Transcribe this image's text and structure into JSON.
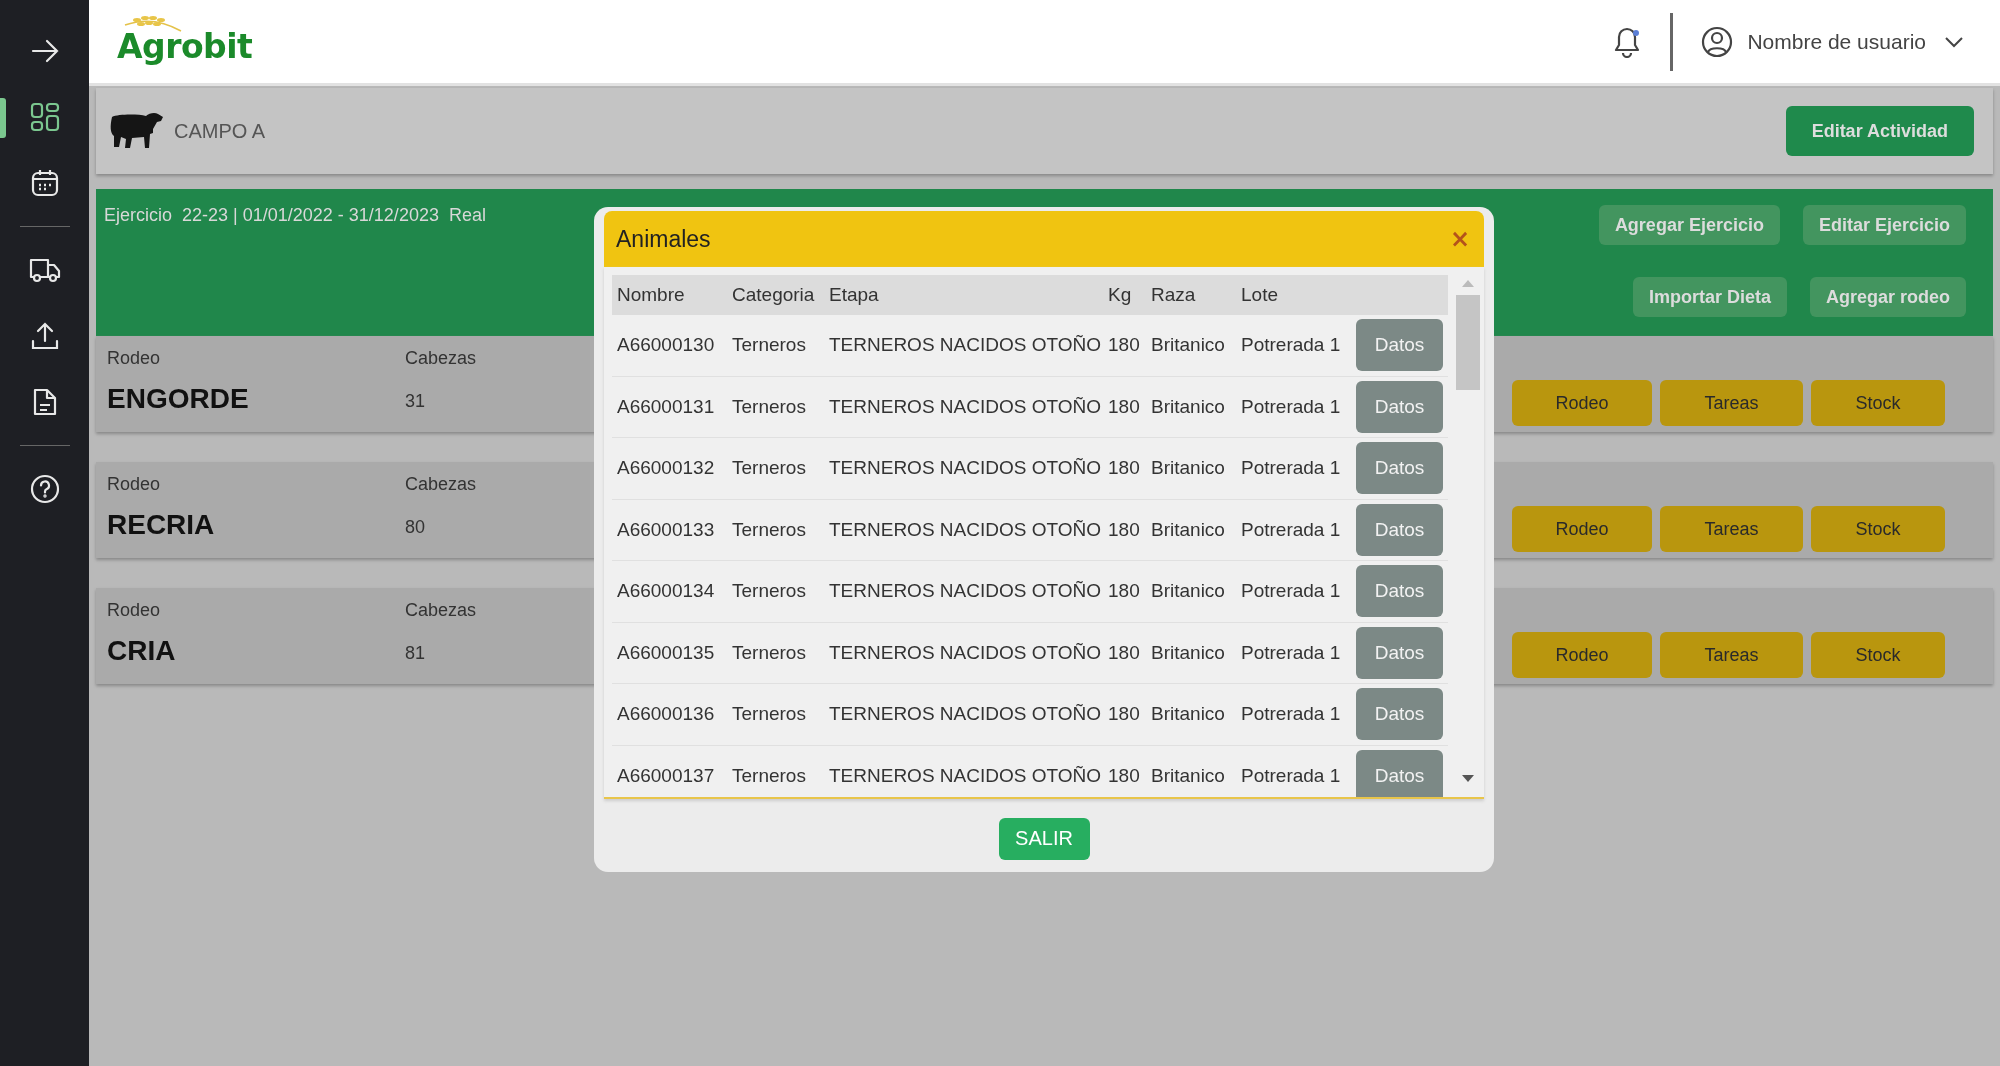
{
  "sidebar": {
    "groups": [
      [
        {
          "kind": "expand",
          "selected": false
        },
        {
          "kind": "dashboard",
          "selected": true
        },
        {
          "kind": "calendar",
          "selected": false
        }
      ],
      [
        {
          "kind": "truck",
          "selected": false
        },
        {
          "kind": "upload",
          "selected": false
        },
        {
          "kind": "document",
          "selected": false
        }
      ],
      [
        {
          "kind": "help",
          "selected": false
        }
      ]
    ]
  },
  "header": {
    "logo": "Agrobit",
    "notification_dot": true,
    "user": "Nombre de usuario"
  },
  "campo": {
    "name": "CAMPO A",
    "button": "Editar Actividad"
  },
  "ejercicio": {
    "label": "Ejercicio",
    "period": "22-23 | 01/01/2022 - 31/12/2023",
    "type": "Real",
    "buttons": [
      [
        "Agregar Ejercicio",
        "Editar Ejercicio"
      ],
      [
        "Importar Dieta",
        "Agregar rodeo"
      ]
    ]
  },
  "rodeos": [
    {
      "label": "Rodeo",
      "name": "ENGORDE",
      "heads_label": "Cabezas",
      "heads": "31",
      "buttons": [
        "Rodeo",
        "Tareas",
        "Stock"
      ]
    },
    {
      "label": "Rodeo",
      "name": "RECRIA",
      "heads_label": "Cabezas",
      "heads": "80",
      "buttons": [
        "Rodeo",
        "Tareas",
        "Stock"
      ]
    },
    {
      "label": "Rodeo",
      "name": "CRIA",
      "heads_label": "Cabezas",
      "heads": "81",
      "buttons": [
        "Rodeo",
        "Tareas",
        "Stock"
      ]
    }
  ],
  "modal": {
    "title": "Animales",
    "close": "×",
    "columns": [
      "Nombre",
      "Categoria",
      "Etapa",
      "Kg",
      "Raza",
      "Lote"
    ],
    "rows": [
      {
        "cells": [
          "A66000130",
          "Terneros",
          "TERNEROS NACIDOS OTOÑO",
          "180",
          "Britanico",
          "Potrerada 1"
        ],
        "button": "Datos"
      },
      {
        "cells": [
          "A66000131",
          "Terneros",
          "TERNEROS NACIDOS OTOÑO",
          "180",
          "Britanico",
          "Potrerada 1"
        ],
        "button": "Datos"
      },
      {
        "cells": [
          "A66000132",
          "Terneros",
          "TERNEROS NACIDOS OTOÑO",
          "180",
          "Britanico",
          "Potrerada 1"
        ],
        "button": "Datos"
      },
      {
        "cells": [
          "A66000133",
          "Terneros",
          "TERNEROS NACIDOS OTOÑO",
          "180",
          "Britanico",
          "Potrerada 1"
        ],
        "button": "Datos"
      },
      {
        "cells": [
          "A66000134",
          "Terneros",
          "TERNEROS NACIDOS OTOÑO",
          "180",
          "Britanico",
          "Potrerada 1"
        ],
        "button": "Datos"
      },
      {
        "cells": [
          "A66000135",
          "Terneros",
          "TERNEROS NACIDOS OTOÑO",
          "180",
          "Britanico",
          "Potrerada 1"
        ],
        "button": "Datos"
      },
      {
        "cells": [
          "A66000136",
          "Terneros",
          "TERNEROS NACIDOS OTOÑO",
          "180",
          "Britanico",
          "Potrerada 1"
        ],
        "button": "Datos"
      },
      {
        "cells": [
          "A66000137",
          "Terneros",
          "TERNEROS NACIDOS OTOÑO",
          "180",
          "Britanico",
          "Potrerada 1"
        ],
        "button": "Datos"
      }
    ],
    "exit_button": "SALIR"
  }
}
